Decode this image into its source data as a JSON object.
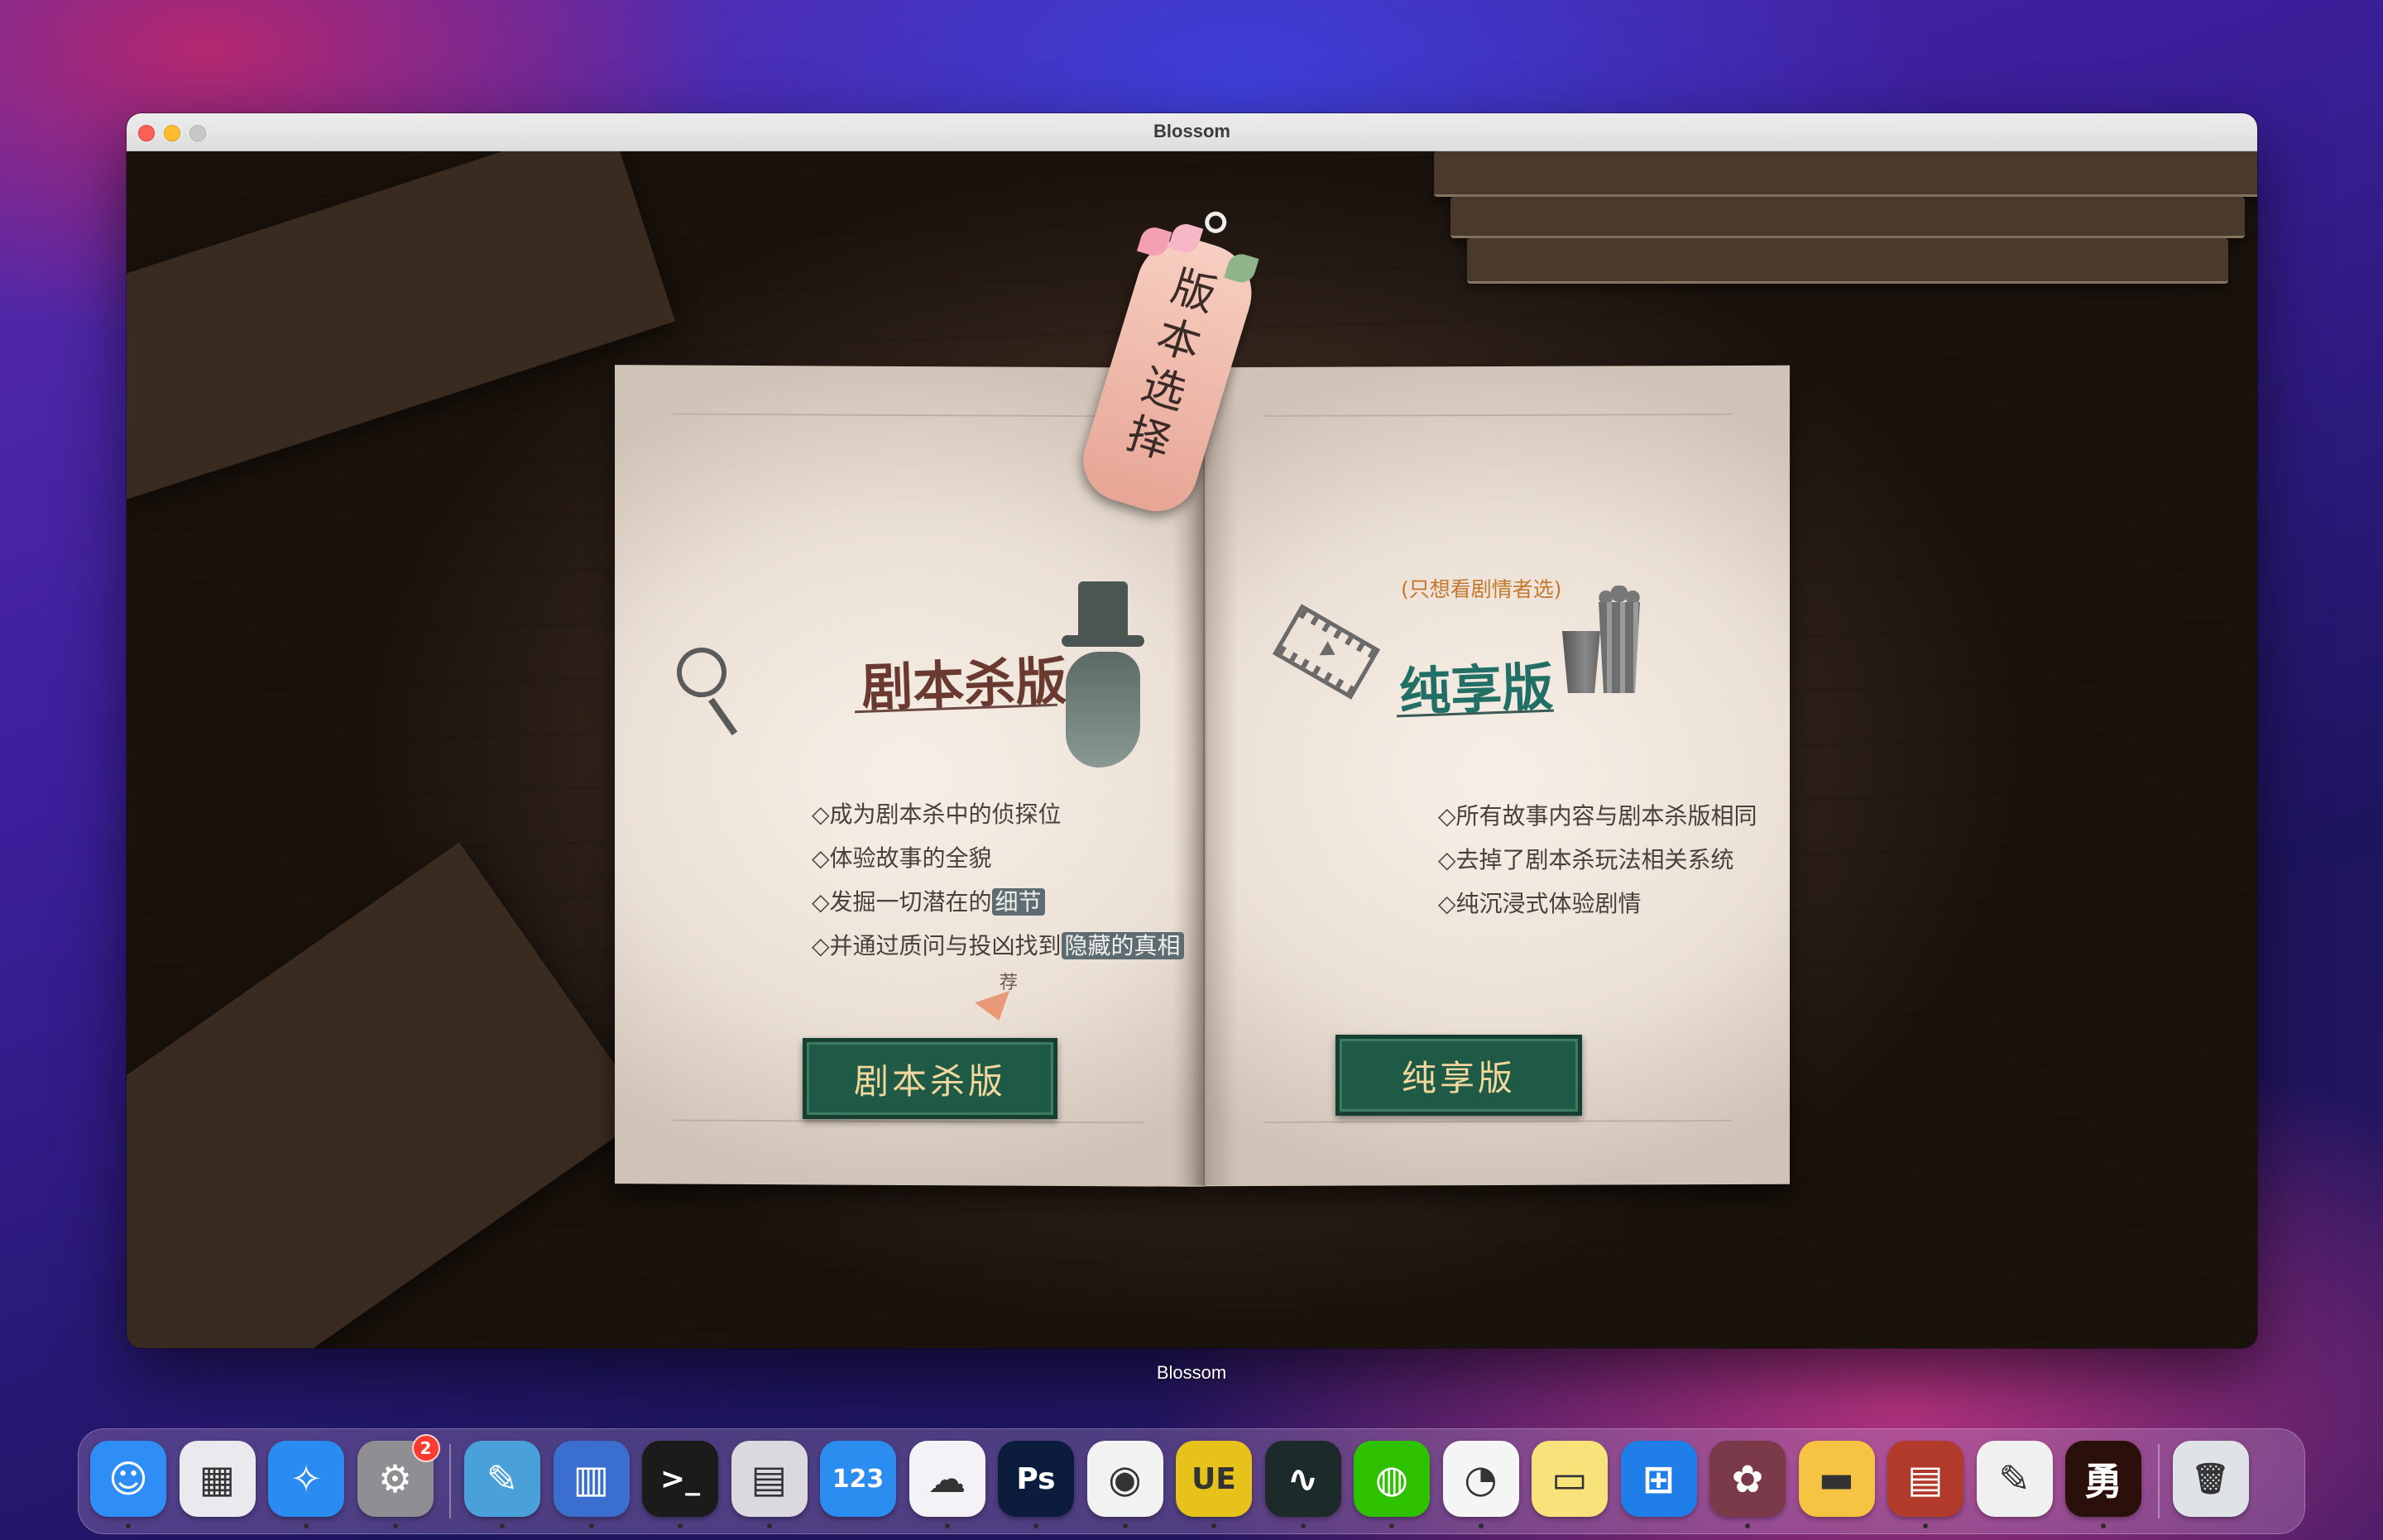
{
  "window": {
    "title": "Blossom"
  },
  "desktop": {
    "window_caption": "Blossom"
  },
  "game": {
    "tag_text": "版本选择",
    "left": {
      "heading": "剧本杀版",
      "bullets": [
        {
          "prefix": "◇成为剧本杀中的侦探位",
          "highlight": ""
        },
        {
          "prefix": "◇体验故事的全貌",
          "highlight": ""
        },
        {
          "prefix": "◇发掘一切潜在的",
          "highlight": "细节"
        },
        {
          "prefix": "◇并通过质问与投凶找到",
          "highlight": "隐藏的真相"
        }
      ],
      "recommend_label": "荐",
      "button_label": "剧本杀版"
    },
    "right": {
      "note": "(只想看剧情者选)",
      "heading": "纯享版",
      "bullets": [
        "◇所有故事内容与剧本杀版相同",
        "◇去掉了剧本杀玩法相关系统",
        "◇纯沉浸式体验剧情"
      ],
      "button_label": "纯享版"
    }
  },
  "dock": {
    "items": [
      {
        "name": "finder-icon",
        "glyph": "☺",
        "color": "#2f8ef5",
        "running": true
      },
      {
        "name": "launchpad-icon",
        "glyph": "▦",
        "color": "#e9e9ee",
        "running": false
      },
      {
        "name": "safari-icon",
        "glyph": "✧",
        "color": "#2a8cf0",
        "running": true
      },
      {
        "name": "system-preferences-icon",
        "glyph": "⚙",
        "color": "#8e8e93",
        "running": true,
        "badge": "2"
      },
      {
        "name": "pixelmator-icon",
        "glyph": "✎",
        "color": "#4aa0d8",
        "running": true
      },
      {
        "name": "parallels-icon",
        "glyph": "▥",
        "color": "#3b6fcf",
        "running": true
      },
      {
        "name": "terminal-icon",
        "glyph": ">_",
        "color": "#1b1b1b",
        "running": true
      },
      {
        "name": "scanner-icon",
        "glyph": "▤",
        "color": "#d9d9df",
        "running": true
      },
      {
        "name": "numbers-icon",
        "glyph": "123",
        "color": "#2c8df0",
        "running": false
      },
      {
        "name": "baidu-netdisk-icon",
        "glyph": "☁",
        "color": "#f2f2f7",
        "running": true
      },
      {
        "name": "photoshop-icon",
        "glyph": "Ps",
        "color": "#0b1c3d",
        "running": true
      },
      {
        "name": "chrome-icon",
        "glyph": "◉",
        "color": "#f2f2f2",
        "running": true
      },
      {
        "name": "unreal-engine-icon",
        "glyph": "UE",
        "color": "#e6c21b",
        "running": true
      },
      {
        "name": "activity-monitor-icon",
        "glyph": "∿",
        "color": "#1d2a2a",
        "running": true
      },
      {
        "name": "wechat-icon",
        "glyph": "◍",
        "color": "#2dc100",
        "running": true
      },
      {
        "name": "qq-icon",
        "glyph": "◔",
        "color": "#f5f5f5",
        "running": true
      },
      {
        "name": "notes-icon",
        "glyph": "▭",
        "color": "#f7e37a",
        "running": false
      },
      {
        "name": "windows-app-icon",
        "glyph": "⊞",
        "color": "#1f7ee8",
        "running": false
      },
      {
        "name": "blossom-game-icon",
        "glyph": "✿",
        "color": "#7a3a4a",
        "running": true
      },
      {
        "name": "folder-icon",
        "glyph": "▬",
        "color": "#f6c343",
        "running": false
      },
      {
        "name": "archive-utility-icon",
        "glyph": "▤",
        "color": "#b23a2a",
        "running": true
      },
      {
        "name": "textedit-icon",
        "glyph": "✎",
        "color": "#f0f0f0",
        "running": false
      },
      {
        "name": "game-yong-icon",
        "glyph": "勇",
        "color": "#2a0f0a",
        "running": true
      },
      {
        "name": "trash-icon",
        "glyph": "🗑",
        "color": "#dfe3e8",
        "running": false
      }
    ]
  }
}
